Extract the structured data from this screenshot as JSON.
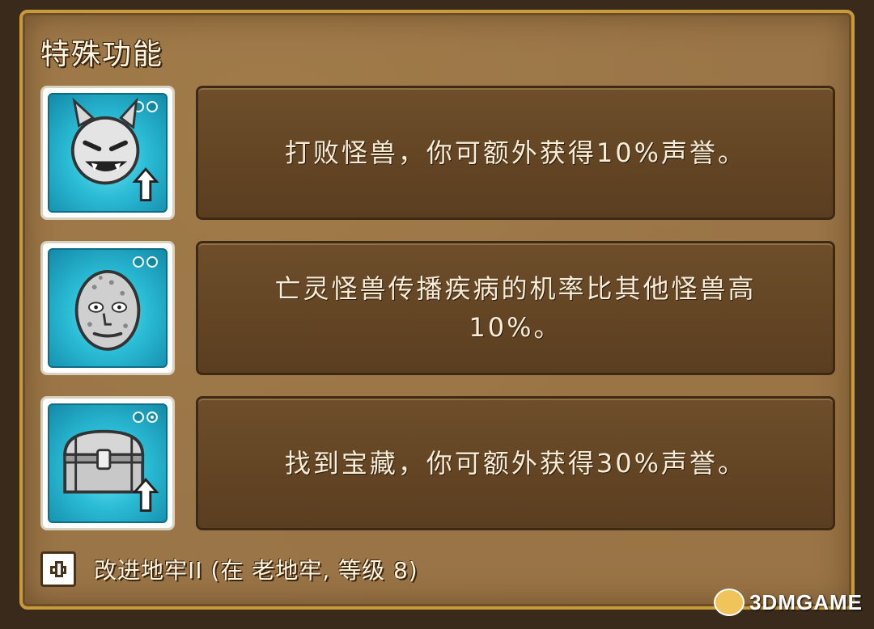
{
  "panel": {
    "title": "特殊功能"
  },
  "features": [
    {
      "icon": "grinning-demon-icon",
      "level_dots": [
        false,
        false
      ],
      "upgrade_arrow": true,
      "description": "打败怪兽，你可额外获得10%声誉。"
    },
    {
      "icon": "undead-zombie-head-icon",
      "level_dots": [
        false,
        false
      ],
      "upgrade_arrow": false,
      "description": "亡灵怪兽传播疾病的机率比其他怪兽高10%。"
    },
    {
      "icon": "treasure-chest-icon",
      "level_dots": [
        false,
        true
      ],
      "upgrade_arrow": true,
      "description": "找到宝藏，你可额外获得30%声誉。"
    }
  ],
  "footer": {
    "text": "改进地牢II (在 老地牢, 等级 8)"
  },
  "watermark": {
    "text": "3DMGAME"
  },
  "colors": {
    "frame_gold": "#c89a3c",
    "panel_brown": "#9a7547",
    "desc_box": "#6e4e2a",
    "icon_cyan": "#2bbcd6"
  }
}
